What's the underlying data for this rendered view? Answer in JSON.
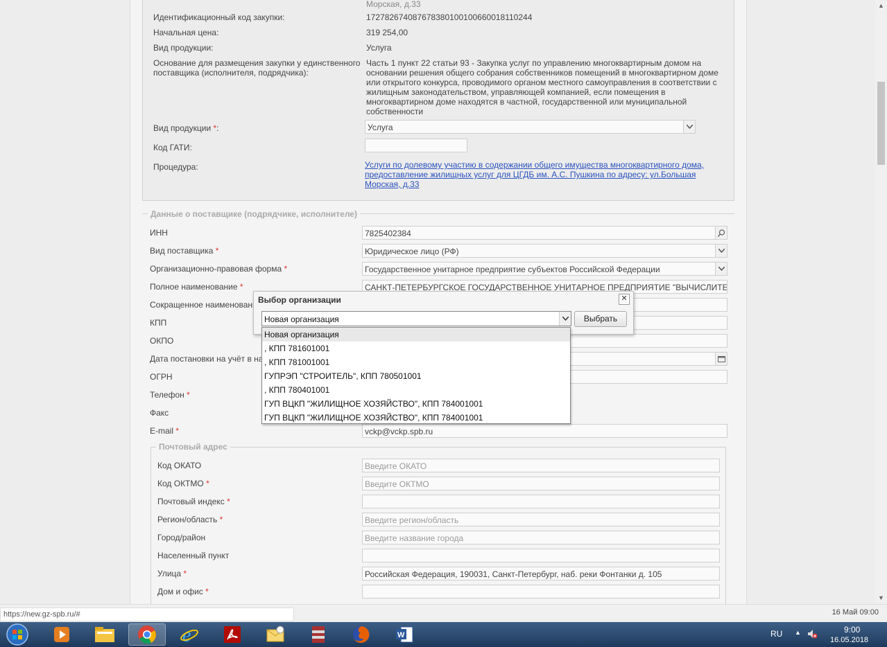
{
  "procurement": {
    "top_cut": "Морская, д.33",
    "fields": [
      {
        "label": "Идентификационный код закупки:",
        "value": "172782674087678380100100660018110244"
      },
      {
        "label": "Начальная цена:",
        "value": "319 254,00"
      },
      {
        "label": "Вид продукции:",
        "value": "Услуга"
      }
    ],
    "basis_label": "Основание для размещения закупки у единственного поставщика (исполнителя, подрядчика):",
    "basis_value": "Часть 1 пункт 22 статьи 93 - Закупка услуг по управлению многоквартирным домом на основании решения общего собрания собственников помещений в многоквартирном доме или открытого конкурса, проводимого органом местного самоуправления в соответствии с жилищным законодательством, управляющей компанией, если помещения в многоквартирном доме находятся в частной, государственной или муниципальной собственности",
    "product_type_label": "Вид продукции",
    "product_type_value": "Услуга",
    "gati_label": "Код ГАТИ:",
    "procedure_label": "Процедура:",
    "procedure_link": "Услуги по долевому участию в содержании общего имущества многоквартирного дома, предоставление жилищных услуг для ЦГДБ им. А.С. Пушкина по адресу: ул.Большая Морская, д.33"
  },
  "supplier": {
    "legend": "Данные о поставщике (подрядчике, исполнителе)",
    "inn_label": "ИНН",
    "inn_value": "7825402384",
    "type_label": "Вид поставщика",
    "type_value": "Юридическое лицо (РФ)",
    "legal_form_label": "Организационно-правовая форма",
    "legal_form_value": "Государственное унитарное предприятие субъектов Российской Федерации",
    "full_name_label": "Полное наименование",
    "full_name_value": "САНКТ-ПЕТЕРБУРГСКОЕ ГОСУДАРСТВЕННОЕ УНИТАРНОЕ ПРЕДПРИЯТИЕ \"ВЫЧИСЛИТЕЛЬНЫЙ",
    "short_name_label": "Сокращенное наименовани",
    "kpp_label": "КПП",
    "okpo_label": "ОКПО",
    "reg_date_label": "Дата постановки на учёт в на",
    "ogrn_label": "ОГРН",
    "phone_label": "Телефон",
    "fax_label": "Факс",
    "email_label": "E-mail",
    "email_value": "vckp@vckp.spb.ru"
  },
  "postal": {
    "legend": "Почтовый адрес",
    "okato_label": "Код ОКАТО",
    "okato_placeholder": "Введите ОКАТО",
    "oktmo_label": "Код ОКТМО",
    "oktmo_placeholder": "Введите ОКТМО",
    "index_label": "Почтовый индекс",
    "region_label": "Регион/область",
    "region_placeholder": "Введите регион/область",
    "city_label": "Город/район",
    "city_placeholder": "Введите название города",
    "settlement_label": "Населенный пункт",
    "street_label": "Улица",
    "street_value": "Российская Федерация, 190031, Санкт-Петербург, наб. реки Фонтанки д. 105",
    "house_label": "Дом и офис"
  },
  "dialog": {
    "title": "Выбор организации",
    "close": "✕",
    "selected": "Новая организация",
    "button": "Выбрать",
    "options": [
      "Новая организация",
      ", КПП 781601001",
      ", КПП 781001001",
      "ГУПРЭП \"СТРОИТЕЛЬ\", КПП 780501001",
      ", КПП 780401001",
      "ГУП ВЦКП \"ЖИЛИЩНОЕ ХОЗЯЙСТВО\", КПП 784001001",
      "ГУП ВЦКП \"ЖИЛИЩНОЕ ХОЗЯЙСТВО\", КПП 784001001"
    ]
  },
  "required_mark": "*",
  "status": {
    "url": "https://new.gz-spb.ru/#",
    "right": "16 Май 09:00"
  },
  "taskbar": {
    "lang": "RU",
    "time": "9:00",
    "date": "16.05.2018",
    "apps": [
      "start-orb-icon",
      "media-player-icon",
      "file-explorer-icon",
      "chrome-icon",
      "internet-explorer-icon",
      "acrobat-icon",
      "outlook-icon",
      "winrar-icon",
      "firefox-icon",
      "word-icon"
    ]
  }
}
